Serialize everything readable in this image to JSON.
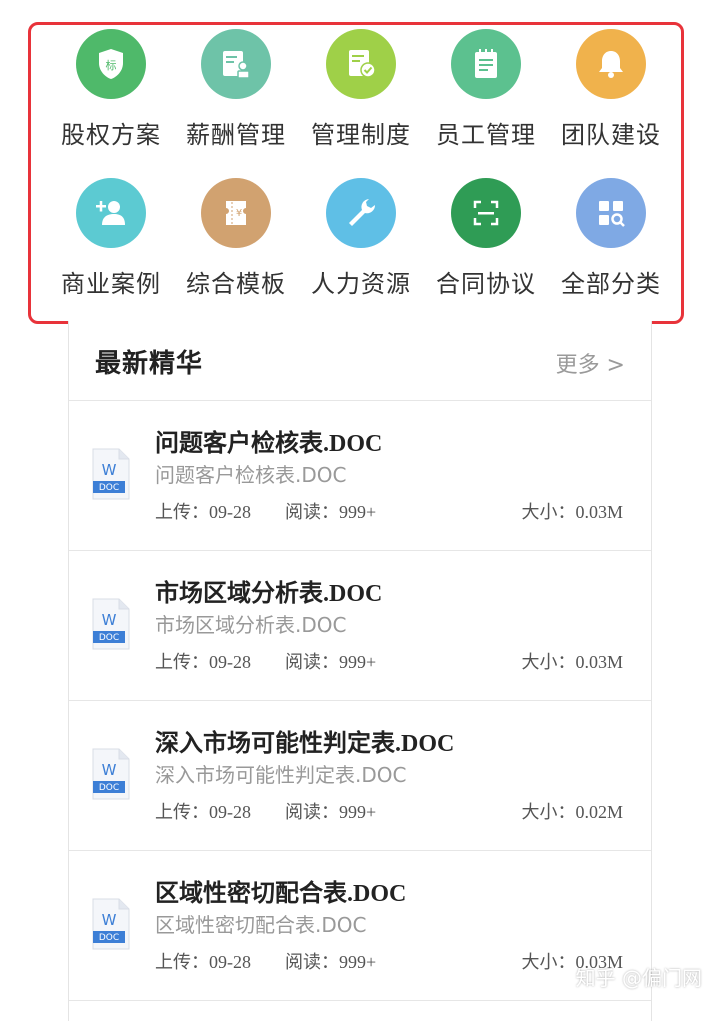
{
  "categories": [
    {
      "label": "股权方案",
      "icon": "shield-icon",
      "color": "#4fb96a",
      "glyph": "标"
    },
    {
      "label": "薪酬管理",
      "icon": "document-stamp-icon",
      "color": "#6ec3a8"
    },
    {
      "label": "管理制度",
      "icon": "document-check-icon",
      "color": "#9fd048"
    },
    {
      "label": "员工管理",
      "icon": "clipboard-icon",
      "color": "#5cc18f"
    },
    {
      "label": "团队建设",
      "icon": "bell-icon",
      "color": "#f0b24c"
    },
    {
      "label": "商业案例",
      "icon": "add-user-icon",
      "color": "#5ccad2"
    },
    {
      "label": "综合模板",
      "icon": "ticket-icon",
      "color": "#d1a270",
      "glyph": "¥"
    },
    {
      "label": "人力资源",
      "icon": "wrench-icon",
      "color": "#5fbfe6"
    },
    {
      "label": "合同协议",
      "icon": "scan-icon",
      "color": "#2f9c55"
    },
    {
      "label": "全部分类",
      "icon": "grid-search-icon",
      "color": "#7fa9e4"
    }
  ],
  "latest": {
    "title": "最新精华",
    "more": "更多 >",
    "items": [
      {
        "title": "问题客户检核表.DOC",
        "subtitle": "问题客户检核表.DOC",
        "upload": "上传：09-28",
        "read": "阅读：999+",
        "size": "大小：0.03M"
      },
      {
        "title": "市场区域分析表.DOC",
        "subtitle": "市场区域分析表.DOC",
        "upload": "上传：09-28",
        "read": "阅读：999+",
        "size": "大小：0.03M"
      },
      {
        "title": "深入市场可能性判定表.DOC",
        "subtitle": "深入市场可能性判定表.DOC",
        "upload": "上传：09-28",
        "read": "阅读：999+",
        "size": "大小：0.02M"
      },
      {
        "title": "区域性密切配合表.DOC",
        "subtitle": "区域性密切配合表.DOC",
        "upload": "上传：09-28",
        "read": "阅读：999+",
        "size": "大小：0.03M"
      }
    ]
  },
  "doc_icon": {
    "letter": "W",
    "tag": "DOC",
    "color": "#3d7fd6"
  },
  "watermark": "知乎 @偏门网"
}
